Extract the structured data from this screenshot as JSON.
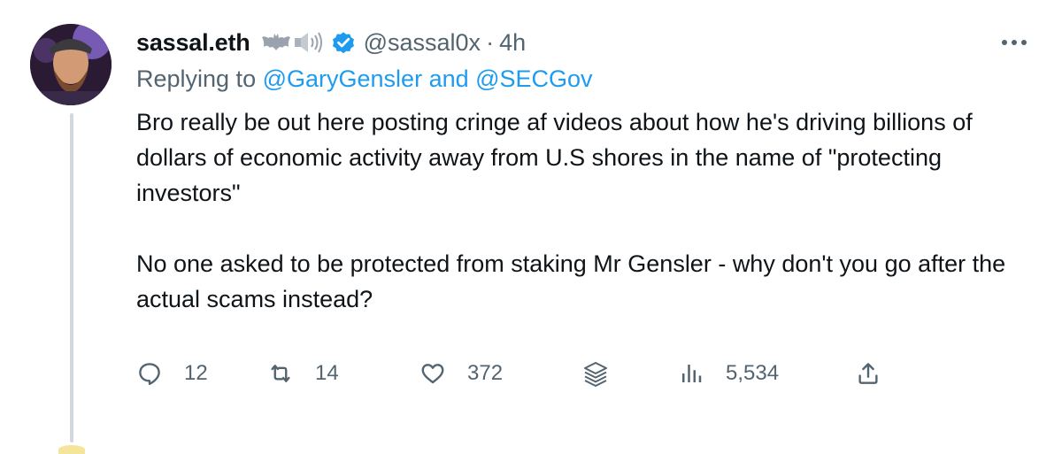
{
  "tweet": {
    "display_name": "sassal.eth",
    "handle": "@sassal0x",
    "separator": "·",
    "time": "4h",
    "replying_prefix": "Replying to",
    "replying_mentions": "@GaryGensler and @SECGov",
    "text_paragraph_1": "Bro really be out here posting cringe af videos about how he's driving billions of dollars of economic activity away from U.S shores in the name of \"protecting investors\"",
    "text_paragraph_2": "No one asked to be protected from staking Mr Gensler - why don't you go after the actual scams instead?",
    "icons": [
      "bat-emoji-icon",
      "speaker-emoji-icon",
      "verified-badge-icon",
      "more-icon"
    ]
  },
  "actions": {
    "reply_count": "12",
    "retweet_count": "14",
    "like_count": "372",
    "views_count": "5,534",
    "icons": [
      "reply-icon",
      "retweet-icon",
      "like-icon",
      "stack-icon",
      "views-icon",
      "share-icon"
    ]
  },
  "colors": {
    "text": "#0f1419",
    "secondary": "#536471",
    "accent": "#1d9bf0",
    "thread_line": "#cfd9de"
  }
}
